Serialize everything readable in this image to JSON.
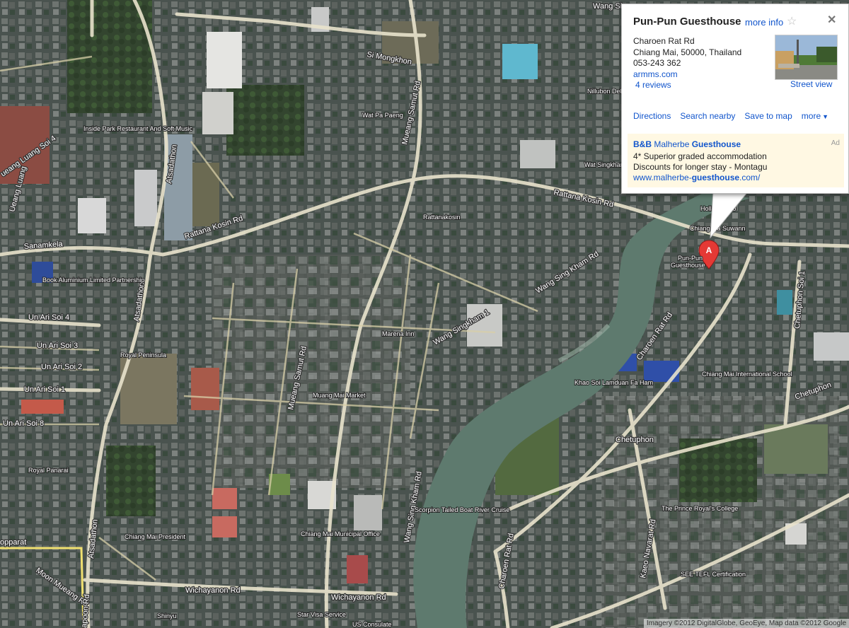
{
  "info_window": {
    "title": "Pun-Pun Guesthouse",
    "more_info": "more info",
    "star_icon": "☆",
    "close_icon": "✕",
    "address_line1": "Charoen Rat Rd",
    "address_line2": "Chiang Mai, 50000, Thailand",
    "phone": "053-243 362",
    "website": "armms.com",
    "reviews": "4 reviews",
    "street_view": "Street view",
    "actions": {
      "directions": "Directions",
      "search_nearby": "Search nearby",
      "save_to_map": "Save to map",
      "more": "more"
    },
    "ad": {
      "title_part1": "B&B",
      "title_part2": "Malherbe",
      "title_part3": "Guesthouse",
      "badge": "Ad",
      "line1": "4* Superior graded accommodation",
      "line2": "Discounts for longer stay - Montagu",
      "url_part1": "www.malherbe-",
      "url_part2": "guesthouse",
      "url_part3": ".com/"
    }
  },
  "marker": {
    "letter": "A",
    "label_line1": "Pun-Pun",
    "label_line2": "Guesthouse"
  },
  "road_labels": {
    "sanamkela": "Sanamkela",
    "rattana_kosin_west": "Rattana Kosin Rd",
    "rattana_kosin_east": "Rattana Kosin Rd",
    "si_mongkhon": "Si Mongkhon",
    "mueang_samut_north": "Mueang Samut Rd",
    "mueang_samut_south": "Mueang Samut Rd",
    "wang_sing_kham": "Wang Sing Kham Rd",
    "wang_sing_kham_1": "Wang Singkham 1",
    "wang_sing_kham_south": "Wang Sing Kham Rd",
    "charoen_rat_north": "Charoen Rat Rd",
    "charoen_rat_south": "Charoen Rat Rd",
    "chetuphon": "Chetuphon",
    "chetuphon_east": "Chetuphon",
    "chetuphon_soi": "Chetuphon Soi 1",
    "kaeo_nawarat": "Kaeo Navarat Rd",
    "atsadathon_north": "Atsadathon",
    "atsadathon_mid": "Atsadathon",
    "atsadathon_south": "Atsadathon",
    "un_ari_soi4": "Un Ari Soi 4",
    "un_ari_soi3": "Un Ari Soi 3",
    "un_ari_soi2": "Un Ari Soi 2",
    "un_ari_soi1": "Un Ari Soi 1",
    "un_ari_soi8": "Un Ari Soi 8",
    "wichayanon_west": "Wichayanon Rd",
    "wichayanon_east": "Wichayanon Rd",
    "moon_mueang": "Moon Mueang Rd",
    "wang_sing_kham_top": "Wang Sing",
    "chareon_rat_lower": "Charoen Rat Rd",
    "ueang_luang_soi4": "ueang Luang Soi 4",
    "ueang_luang_soi3": "ueang Luang Soi 3",
    "ueang_luang": "Ueang Luang",
    "opparat": "opparat",
    "apoon_rd": "apoon Rd"
  },
  "poi_labels": {
    "wat_pa_paeng": "Wat Pa Paeng",
    "inside_park": "Inside Park Restaurant And Soft Music",
    "nillubon": "Nillubon Deli Sweets H",
    "wat_singkham": "Wat Singkham Ice Factory",
    "hollanda": "Hollanda Mo",
    "chiang_mai_suwan": "Chiang Ma Suwann",
    "rattanakosin": "Rattanakosin",
    "book_aluminium": "Book Aluminium Limited Partnership",
    "royal_peninsula": "Royal Peninsula",
    "marena_inn": "Marena Inn",
    "muang_mai_market": "Muang Mai Market",
    "khao_soi": "Khao Soi Lamduan Fa Ham",
    "chiang_mai_intl": "Chiang Mai International School",
    "royal_panarai": "Royal Panarai",
    "chiang_mai_president": "Chiang Mai President",
    "chiang_mai_municipal": "Chiang Mai Municipal Office",
    "scorpion": "Scorpion Tailed Boat River Cruise",
    "prince_royal": "The Prince Royal's College",
    "see_tefl": "SEE TEFL Certification",
    "star_visa": "Star Visa Service",
    "us_consulate": "US Consulate",
    "shinyu": "Shinyu"
  },
  "copyright": "Imagery ©2012 DigitalGlobe, GeoEye, Map data ©2012 Google",
  "colors": {
    "link": "#1155cc",
    "marker": "#e53935",
    "ad_background": "#fff8e3",
    "river": "#5e7a6e"
  }
}
